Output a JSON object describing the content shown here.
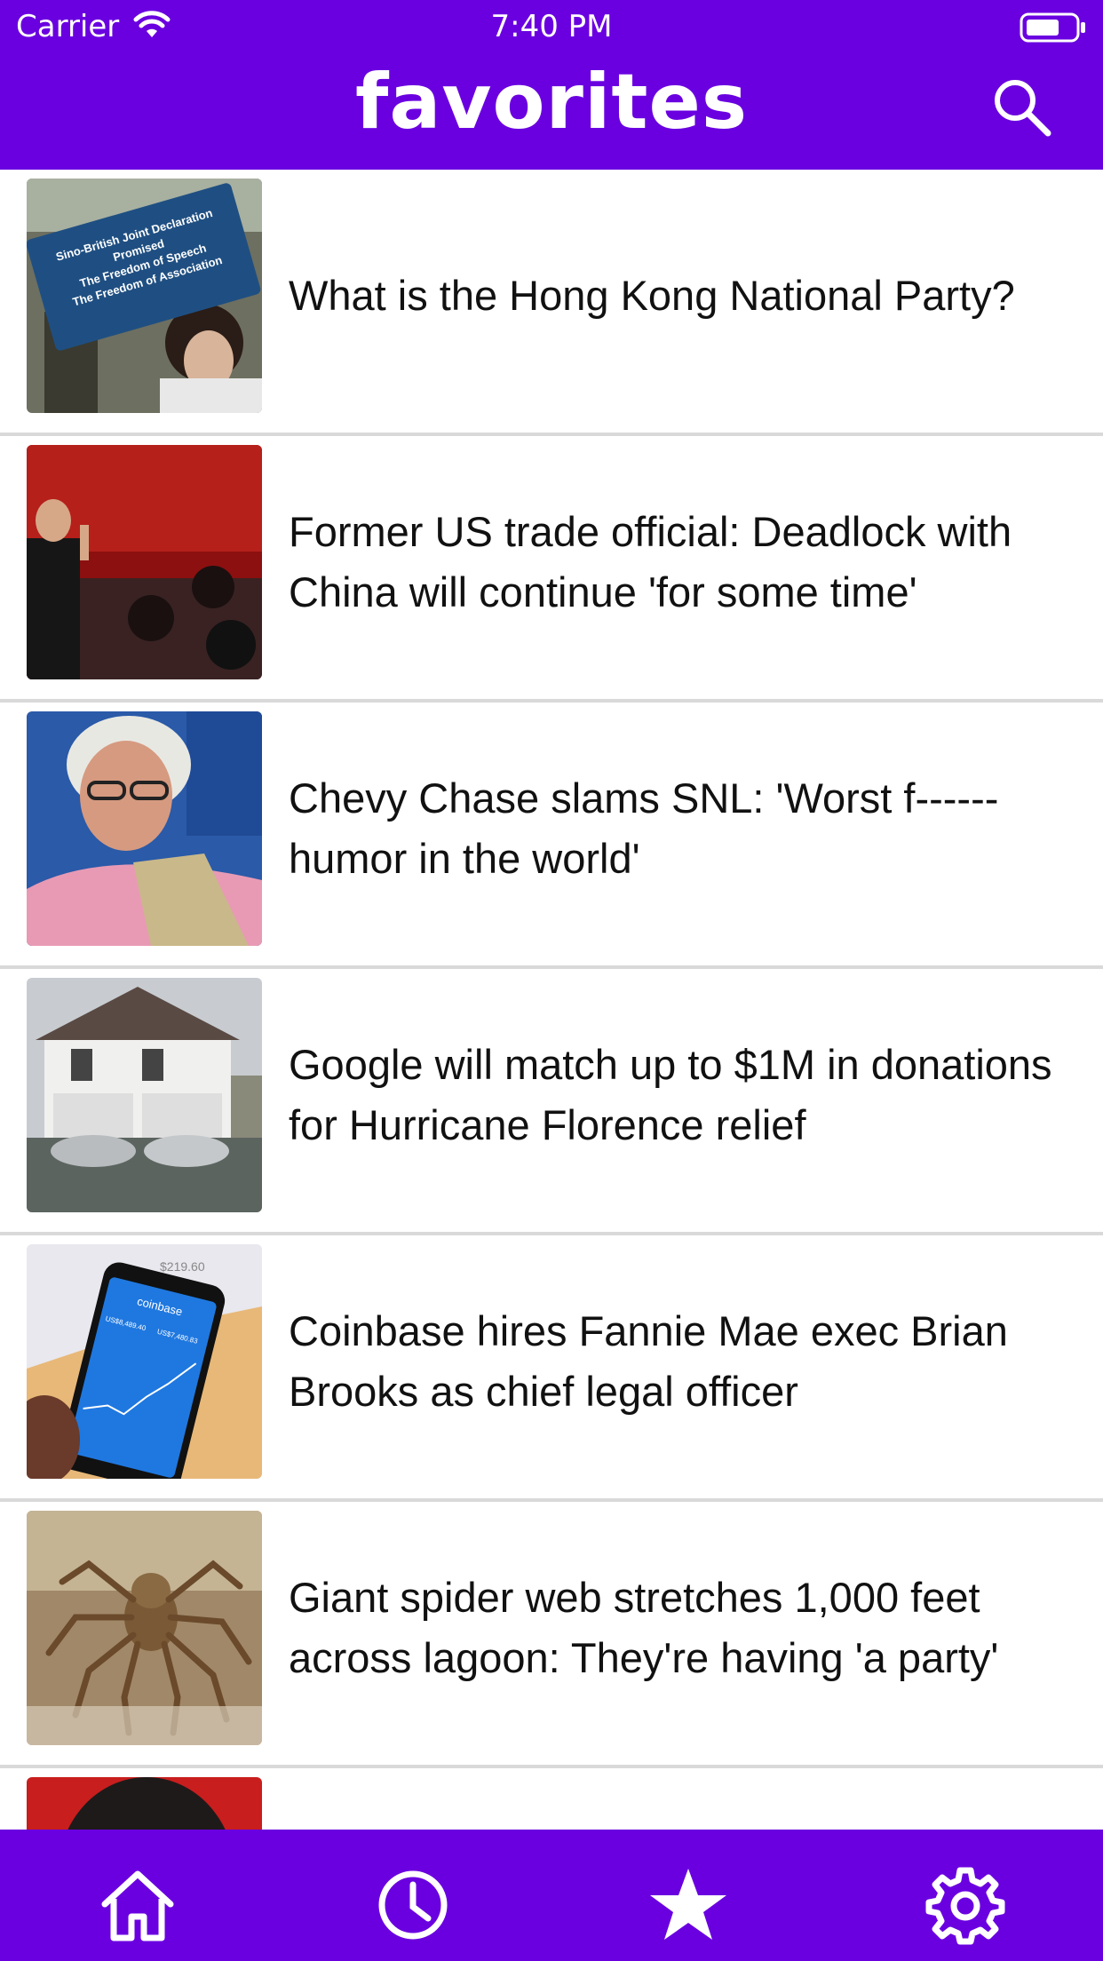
{
  "status_bar": {
    "carrier": "Carrier",
    "time": "7:40 PM"
  },
  "header": {
    "title": "favorites",
    "search_icon": "search-icon"
  },
  "articles": [
    {
      "headline": "What is the Hong Kong National Party?",
      "image": "protest-sign-photo",
      "sign_text": [
        "Sino-British Joint Declaration",
        "Promised",
        "The Freedom of Speech",
        "The Freedom of Association"
      ]
    },
    {
      "headline": "Former US trade official: Deadlock with China will continue 'for some time'",
      "image": "official-waving-photo"
    },
    {
      "headline": "Chevy Chase slams SNL: 'Worst f------ humor in the world'",
      "image": "man-with-glasses-photo"
    },
    {
      "headline": "Google will match up to $1M in donations for Hurricane Florence relief",
      "image": "flooded-house-photo"
    },
    {
      "headline": "Coinbase hires Fannie Mae exec Brian Brooks as chief legal officer",
      "image": "phone-app-photo",
      "phone_text": {
        "top": "$219.60",
        "brand": "coinbase",
        "left_value": "US$8,489.40",
        "right_value": "US$7,480.83"
      }
    },
    {
      "headline": "Giant spider web stretches 1,000 feet across lagoon: They're having 'a party'",
      "image": "spider-photo"
    },
    {
      "headline": "",
      "image": "partial-portrait-photo"
    }
  ],
  "tabbar": {
    "tabs": [
      {
        "name": "home",
        "icon": "home-icon",
        "active": false
      },
      {
        "name": "history",
        "icon": "clock-icon",
        "active": false
      },
      {
        "name": "favorites",
        "icon": "star-icon",
        "active": true
      },
      {
        "name": "settings",
        "icon": "gear-icon",
        "active": false
      }
    ]
  },
  "colors": {
    "brand": "#6a00e0",
    "divider": "#d9d9d9",
    "text": "#111111"
  }
}
